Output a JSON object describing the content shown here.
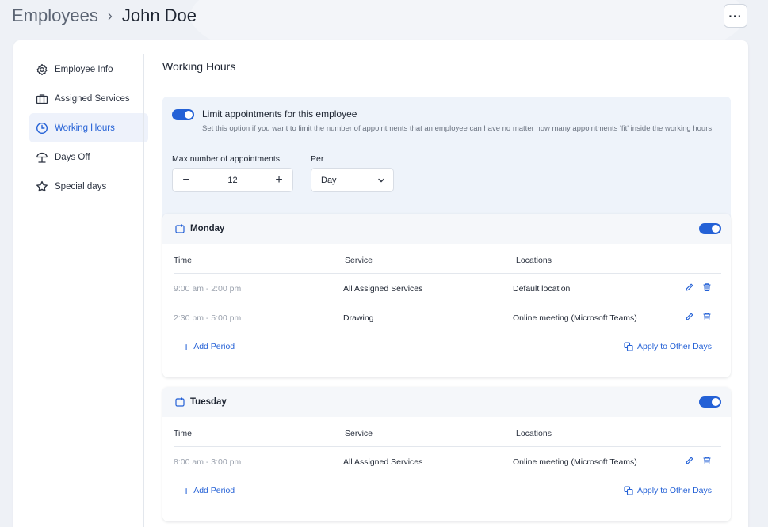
{
  "header": {
    "root": "Employees",
    "separator": "›",
    "current": "John Doe",
    "more": "···"
  },
  "sidebar": {
    "items": [
      {
        "label": "Employee Info",
        "icon": "gear-icon"
      },
      {
        "label": "Assigned Services",
        "icon": "briefcase-icon"
      },
      {
        "label": "Working Hours",
        "icon": "clock-icon",
        "active": true
      },
      {
        "label": "Days Off",
        "icon": "beach-umbrella-icon"
      },
      {
        "label": "Special days",
        "icon": "star-icon"
      }
    ]
  },
  "main": {
    "title": "Working Hours",
    "limit": {
      "label": "Limit appointments for this employee",
      "help": "Set this option if you want to limit the number of appointments that an employee can have no matter how many appointments 'fit' inside the working hours",
      "max_label": "Max number of appointments",
      "per_label": "Per",
      "max_value": "12",
      "minus": "−",
      "plus": "+",
      "per_value": "Day"
    },
    "columns": {
      "time": "Time",
      "service": "Service",
      "locations": "Locations"
    },
    "add_period": "Add Period",
    "apply_other": "Apply to Other Days",
    "days": [
      {
        "name": "Monday",
        "rows": [
          {
            "time": "9:00 am - 2:00 pm",
            "service": "All Assigned Services",
            "location": "Default location"
          },
          {
            "time": "2:30 pm - 5:00 pm",
            "service": "Drawing",
            "location": "Online meeting (Microsoft Teams)"
          }
        ]
      },
      {
        "name": "Tuesday",
        "rows": [
          {
            "time": "8:00 am - 3:00 pm",
            "service": "All Assigned Services",
            "location": "Online meeting (Microsoft Teams)"
          }
        ]
      }
    ]
  },
  "colors": {
    "accent": "#2461d6",
    "panel": "#eef3fa"
  }
}
